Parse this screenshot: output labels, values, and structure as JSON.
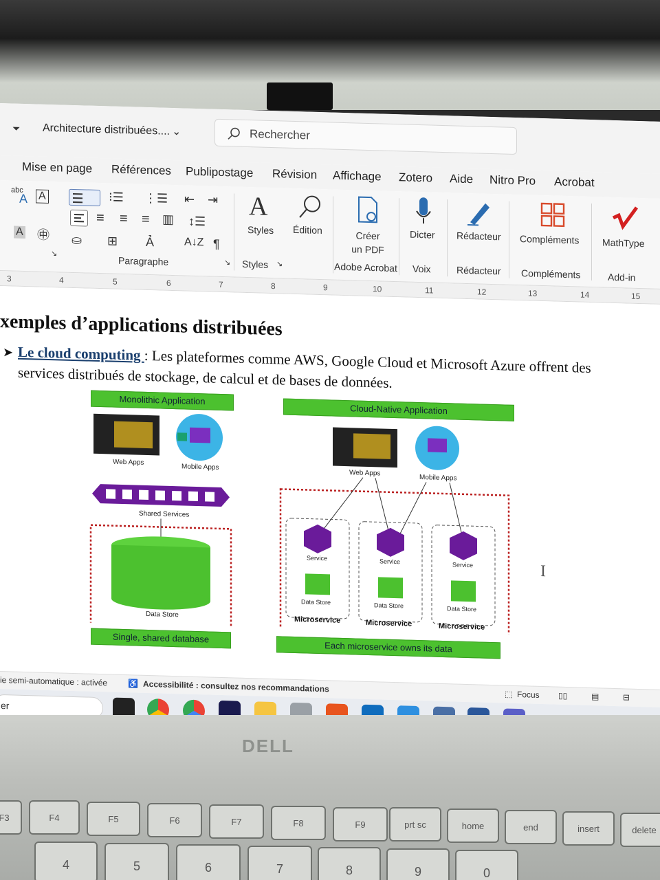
{
  "window": {
    "doc_title": "Architecture distribuées....",
    "search_placeholder": "Rechercher"
  },
  "tabs": [
    "Mise en page",
    "Références",
    "Publipostage",
    "Révision",
    "Affichage",
    "Zotero",
    "Aide",
    "Nitro Pro",
    "Acrobat"
  ],
  "ribbon": {
    "paragraph_label": "Paragraphe",
    "styles_btn": "Styles",
    "styles_group": "Styles",
    "edition_btn": "Édition",
    "creer_pdf": "Créer un PDF",
    "adobe_group": "Adobe Acrobat",
    "dicter_btn": "Dicter",
    "voix_group": "Voix",
    "redacteur_btn": "Rédacteur",
    "redacteur_group": "Rédacteur",
    "complements_btn": "Compléments",
    "complements_group": "Compléments",
    "mathtype_btn": "MathType",
    "addin_group": "Add-in"
  },
  "ruler": [
    "3",
    "4",
    "5",
    "6",
    "7",
    "8",
    "9",
    "10",
    "11",
    "12",
    "13",
    "14",
    "15"
  ],
  "document": {
    "heading": "xemples d’applications distribuées",
    "link_text": "Le cloud computing ",
    "paragraph": ": Les plateformes comme AWS, Google Cloud et Microsoft Azure offrent des services distribués de stockage, de calcul et de bases de données."
  },
  "figure": {
    "mono_title": "Monolithic Application",
    "cloud_title": "Cloud-Native Application",
    "web_apps": "Web Apps",
    "mobile_apps": "Mobile Apps",
    "shared_services": "Shared Services",
    "data_store": "Data Store",
    "service": "Service",
    "microservice": "Microservice",
    "single_db": "Single, shared database",
    "each_owns": "Each microservice owns its data"
  },
  "statusbar": {
    "left": "ie semi-automatique : activée",
    "accessibility": "Accessibilité : consultez nos recommandations",
    "focus": "Focus"
  },
  "taskbar": {
    "search_text": "er"
  },
  "laptop": {
    "brand": "DELL",
    "fn_keys": [
      "F3",
      "F4",
      "F5",
      "F6",
      "F7",
      "F8",
      "F9",
      "prt sc",
      "home",
      "end",
      "insert",
      "delete"
    ],
    "num_keys": [
      "4",
      "5",
      "6",
      "7",
      "8",
      "9",
      "0"
    ]
  },
  "colors": {
    "accent_green": "#4cc12f",
    "purple": "#6a1b9a",
    "word_blue": "#2b579a"
  }
}
